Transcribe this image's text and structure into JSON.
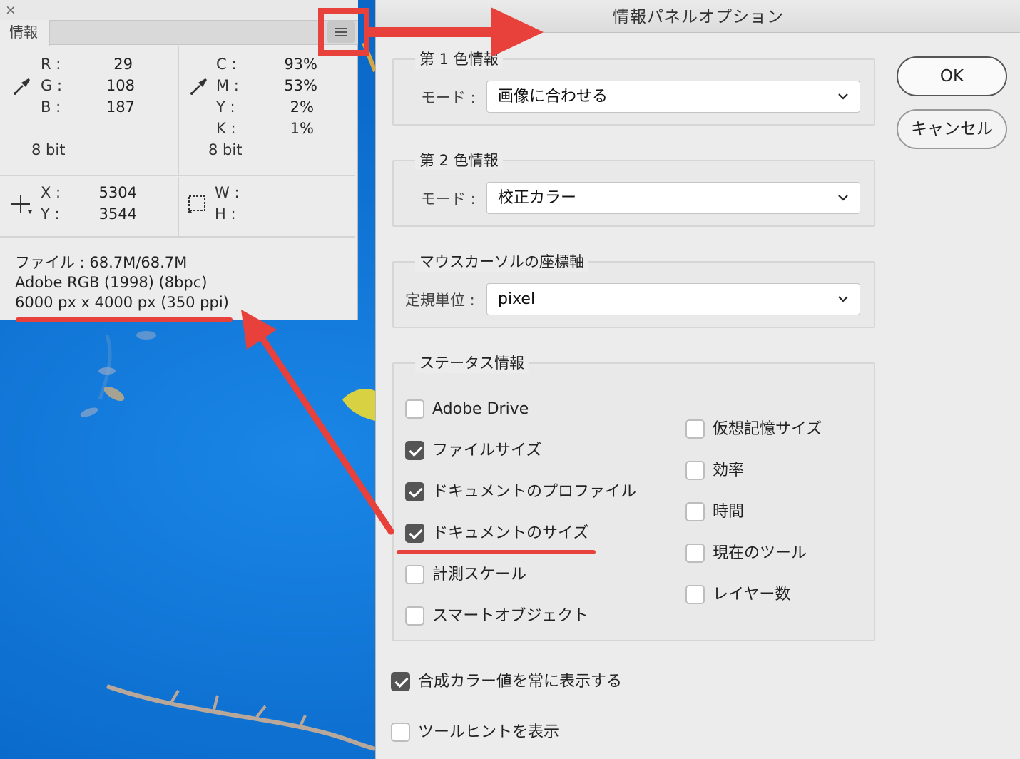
{
  "info_panel": {
    "close_glyph": "×",
    "tab_label": "情報",
    "rgb": [
      {
        "label": "R :",
        "value": "29"
      },
      {
        "label": "G :",
        "value": "108"
      },
      {
        "label": "B :",
        "value": "187"
      }
    ],
    "rgb_bit": "8 bit",
    "cmyk": [
      {
        "label": "C :",
        "value": "93%"
      },
      {
        "label": "M :",
        "value": "53%"
      },
      {
        "label": "Y :",
        "value": "2%"
      },
      {
        "label": "K :",
        "value": "1%"
      }
    ],
    "cmyk_bit": "8 bit",
    "coords": [
      {
        "label": "X :",
        "value": "5304"
      },
      {
        "label": "Y :",
        "value": "3544"
      }
    ],
    "size": [
      {
        "label": "W :",
        "value": ""
      },
      {
        "label": "H :",
        "value": ""
      }
    ],
    "status_lines": [
      "ファイル : 68.7M/68.7M",
      "Adobe RGB (1998) (8bpc)",
      "6000 px x 4000 px (350 ppi)"
    ]
  },
  "dialog": {
    "title": "情報パネルオプション",
    "ok_label": "OK",
    "cancel_label": "キャンセル",
    "group1": {
      "title": "第 1 色情報",
      "mode_label": "モード :",
      "mode_value": "画像に合わせる"
    },
    "group2": {
      "title": "第 2 色情報",
      "mode_label": "モード :",
      "mode_value": "校正カラー"
    },
    "group3": {
      "title": "マウスカーソルの座標軸",
      "unit_label": "定規単位 :",
      "unit_value": "pixel"
    },
    "status_group": {
      "title": "ステータス情報",
      "left": [
        {
          "label": "Adobe Drive",
          "checked": false
        },
        {
          "label": "ファイルサイズ",
          "checked": true
        },
        {
          "label": "ドキュメントのプロファイル",
          "checked": true
        },
        {
          "label": "ドキュメントのサイズ",
          "checked": true
        },
        {
          "label": "計測スケール",
          "checked": false
        },
        {
          "label": "スマートオブジェクト",
          "checked": false
        }
      ],
      "right": [
        {
          "label": "仮想記憶サイズ",
          "checked": false
        },
        {
          "label": "効率",
          "checked": false
        },
        {
          "label": "時間",
          "checked": false
        },
        {
          "label": "現在のツール",
          "checked": false
        },
        {
          "label": "レイヤー数",
          "checked": false
        }
      ]
    },
    "composite_color": {
      "label": "合成カラー値を常に表示する",
      "checked": true
    },
    "tool_hints": {
      "label": "ツールヒントを表示",
      "checked": false
    }
  },
  "colors": {
    "annotation_red": "#e8403a",
    "photo_blue": "#0d72d2"
  }
}
